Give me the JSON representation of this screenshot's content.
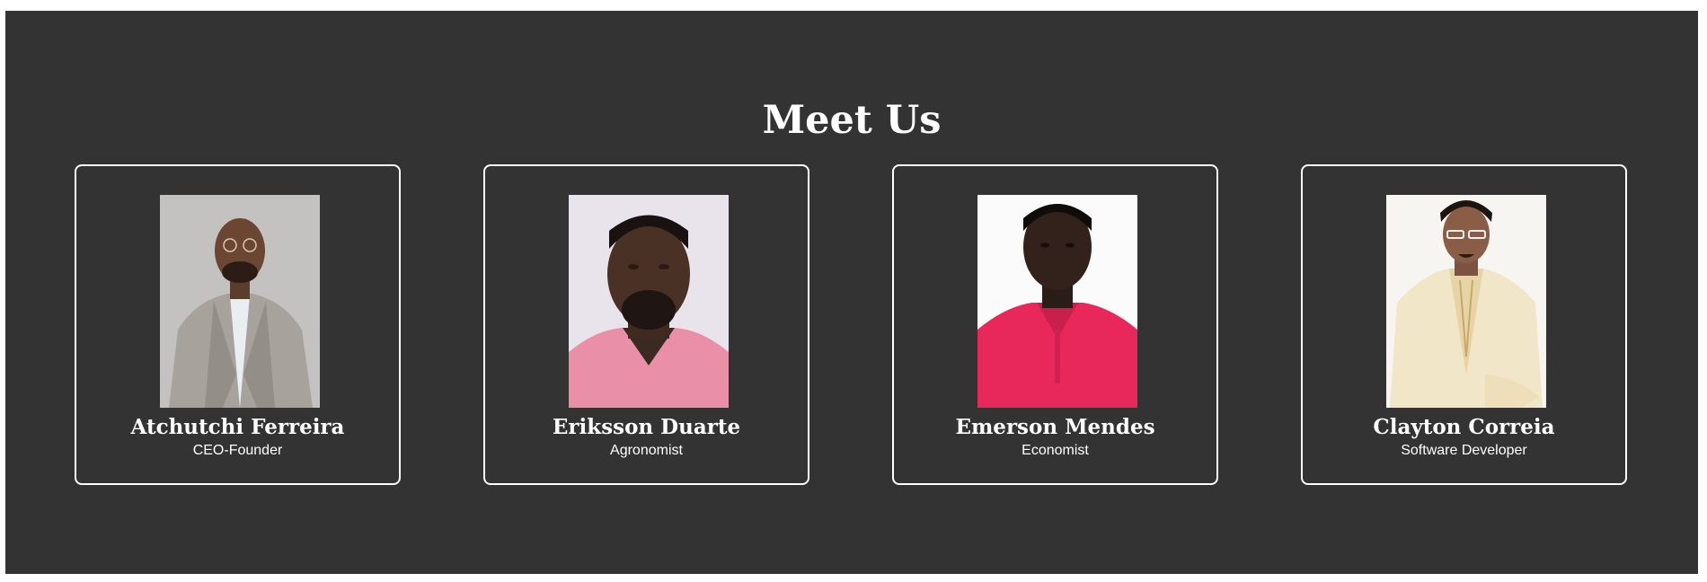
{
  "section": {
    "title": "Meet Us",
    "background": "#333333"
  },
  "team": [
    {
      "name": "Atchutchi Ferreira",
      "role": "CEO-Founder",
      "photo_icon": "portrait-photo"
    },
    {
      "name": "Eriksson Duarte",
      "role": "Agronomist",
      "photo_icon": "portrait-photo"
    },
    {
      "name": "Emerson Mendes",
      "role": "Economist",
      "photo_icon": "portrait-photo"
    },
    {
      "name": "Clayton Correia",
      "role": "Software Developer",
      "photo_icon": "portrait-photo"
    }
  ]
}
